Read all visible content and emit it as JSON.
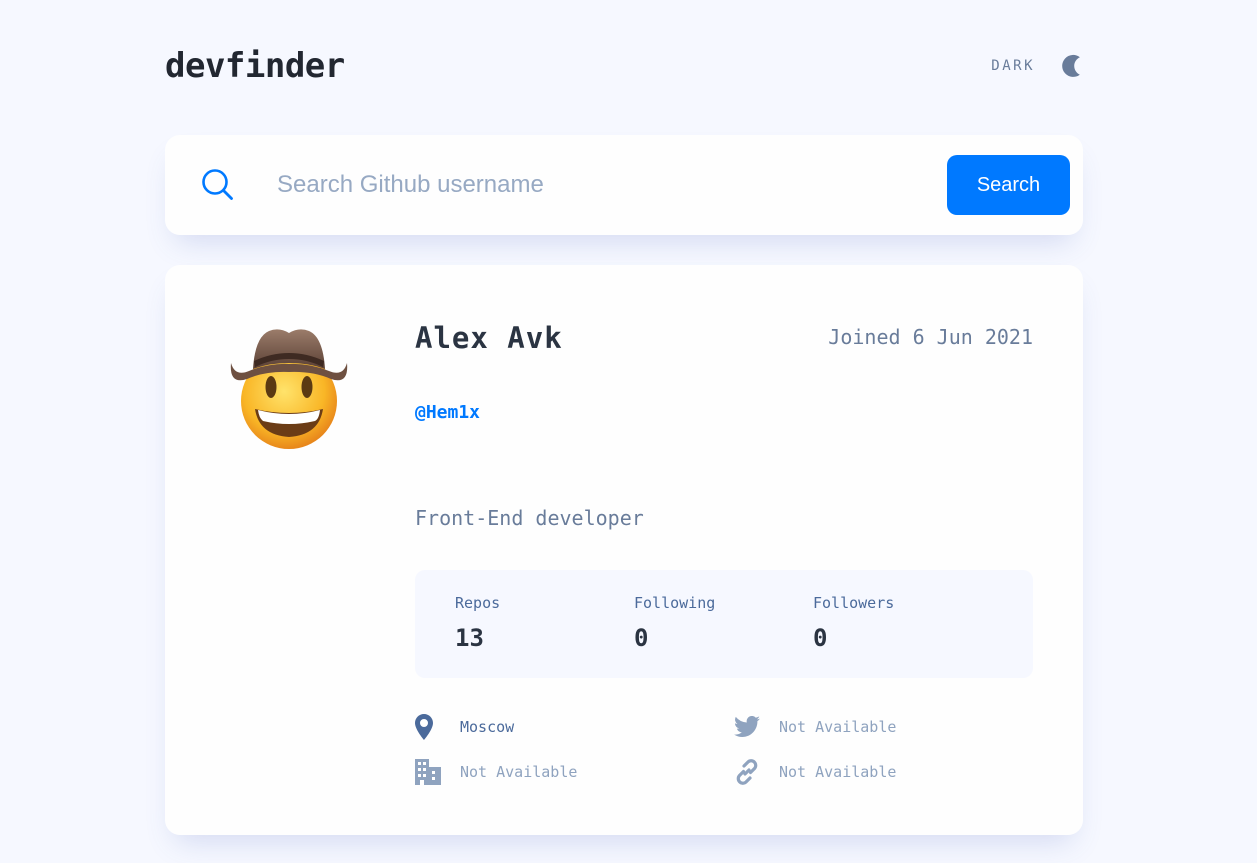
{
  "app": {
    "logo": "devfinder"
  },
  "theme": {
    "label": "DARK",
    "icon": "moon-icon"
  },
  "search": {
    "placeholder": "Search Github username",
    "value": "",
    "button_label": "Search",
    "icon": "search-icon"
  },
  "profile": {
    "name": "Alex Avk",
    "joined": "Joined 6 Jun 2021",
    "login": "@Hem1x",
    "bio": "Front-End developer",
    "avatar": "cowboy-face-icon",
    "stats": [
      {
        "label": "Repos",
        "value": "13"
      },
      {
        "label": "Following",
        "value": "0"
      },
      {
        "label": "Followers",
        "value": "0"
      }
    ],
    "links": {
      "location": "Moscow",
      "twitter": "Not Available",
      "company": "Not Available",
      "blog": "Not Available"
    }
  },
  "colors": {
    "accent": "#0079ff",
    "background": "#f6f8ff",
    "card": "#fefefe",
    "text_dark": "#2b3442",
    "text_muted": "#697c9a"
  }
}
